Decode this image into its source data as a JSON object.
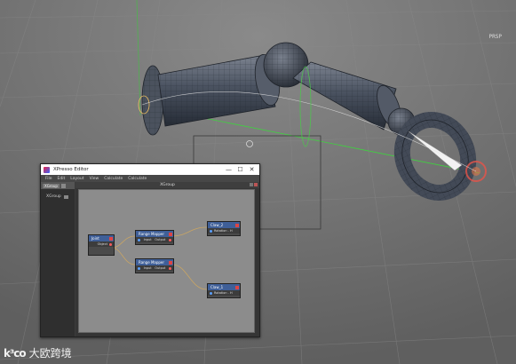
{
  "viewport": {
    "zoom_badge": "PRSP"
  },
  "watermark": {
    "logo": "k³co",
    "text": "大欧跨境"
  },
  "xpresso": {
    "window_title": "XPresso Editor",
    "window_buttons": [
      "—",
      "☐",
      "✕"
    ],
    "menu": [
      "File",
      "Edit",
      "Layout",
      "View",
      "Calculate",
      "Calculate"
    ],
    "left_tab": "XGroup",
    "tree_item": "XGroup",
    "graph_title": "XGroup",
    "nodes": {
      "joint": {
        "title": "Joint",
        "port_out": "Object"
      },
      "range1": {
        "title": "Range Mapper",
        "port_in": "Input",
        "port_out": "Output"
      },
      "range2": {
        "title": "Range Mapper",
        "port_in": "Input",
        "port_out": "Output"
      },
      "claw2": {
        "title": "Claw_2",
        "port_in": "Rotation . H"
      },
      "claw1": {
        "title": "Claw_1",
        "port_in": "Rotation . H"
      }
    }
  },
  "colors": {
    "node_title_bg": "#3f5f98",
    "wire_color": "#c9a564",
    "graph_bg": "#8c8c8c"
  }
}
